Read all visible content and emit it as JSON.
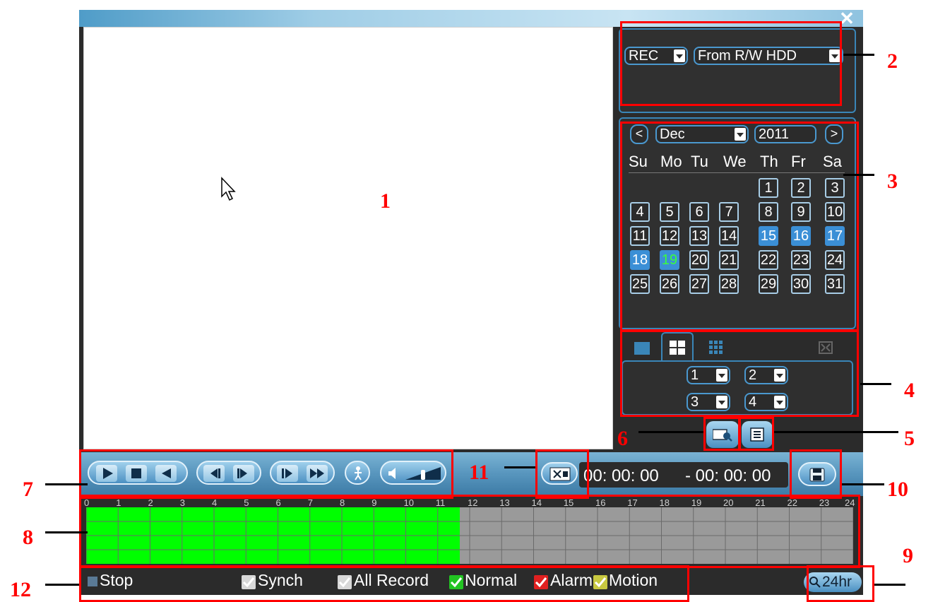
{
  "panel": {
    "type_select": "REC",
    "source_select": "From R/W HDD",
    "month_select": "Dec",
    "year_select": "2011",
    "prev_label": "<",
    "next_label": ">",
    "weekdays": [
      "Su",
      "Mo",
      "Tu",
      "We",
      "Th",
      "Fr",
      "Sa"
    ]
  },
  "calendar": {
    "month": "Dec",
    "year": "2011",
    "recorded_days": [
      15,
      16,
      17,
      18
    ],
    "today_day": 19
  },
  "channels": [
    "1",
    "2",
    "3",
    "4"
  ],
  "playback": {
    "start_time": "00: 00: 00",
    "end_time": "- 00: 00: 00"
  },
  "timeline": {
    "hours": [
      "0",
      "1",
      "2",
      "3",
      "4",
      "5",
      "6",
      "7",
      "8",
      "9",
      "10",
      "11",
      "12",
      "13",
      "14",
      "15",
      "16",
      "17",
      "18",
      "19",
      "20",
      "21",
      "22",
      "23",
      "24"
    ],
    "recorded_until_hour": 11.7,
    "colors": {
      "recorded": "#00ff00",
      "empty": "#9a9a9a"
    }
  },
  "legend": {
    "stop": "Stop",
    "synch": "Synch",
    "all_record": "All Record",
    "normal": "Normal",
    "alarm": "Alarm",
    "motion": "Motion",
    "range": "24hr"
  },
  "callouts": [
    "1",
    "2",
    "3",
    "4",
    "5",
    "6",
    "7",
    "8",
    "9",
    "10",
    "11",
    "12"
  ],
  "colors": {
    "accent": "#3b8fd6",
    "annotation": "#ff0000",
    "normal": "#22c422",
    "alarm": "#e02020",
    "motion": "#c8c840"
  }
}
